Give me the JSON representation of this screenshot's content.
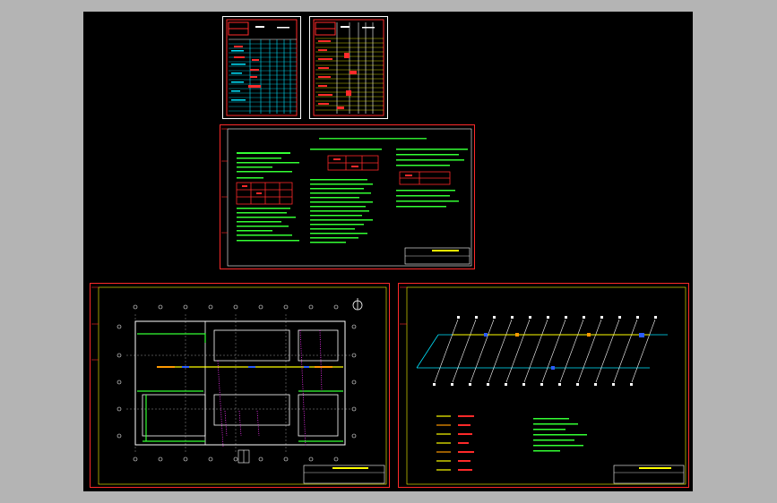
{
  "app": {
    "title": "",
    "viewport_background": "#b4b4b4",
    "model_space_background": "#000000"
  },
  "colors": {
    "frame_white": "#ffffff",
    "frame_red": "#ff2a2a",
    "grid_cyan": "#00e5ff",
    "text_green": "#33ff33",
    "text_yellow": "#ffff00",
    "pipe_magenta": "#ff33ff",
    "pipe_blue": "#2a5cff",
    "pipe_orange": "#ff9900"
  },
  "sheets": [
    {
      "id": "material-list-1",
      "kind": "table-sheet"
    },
    {
      "id": "material-list-2",
      "kind": "table-sheet"
    },
    {
      "id": "design-notes",
      "kind": "notes-sheet"
    },
    {
      "id": "floor-plan",
      "kind": "plan-sheet"
    },
    {
      "id": "system-diagram",
      "kind": "isometric-sheet"
    }
  ],
  "icons": {
    "north_arrow": "north-arrow-icon"
  }
}
